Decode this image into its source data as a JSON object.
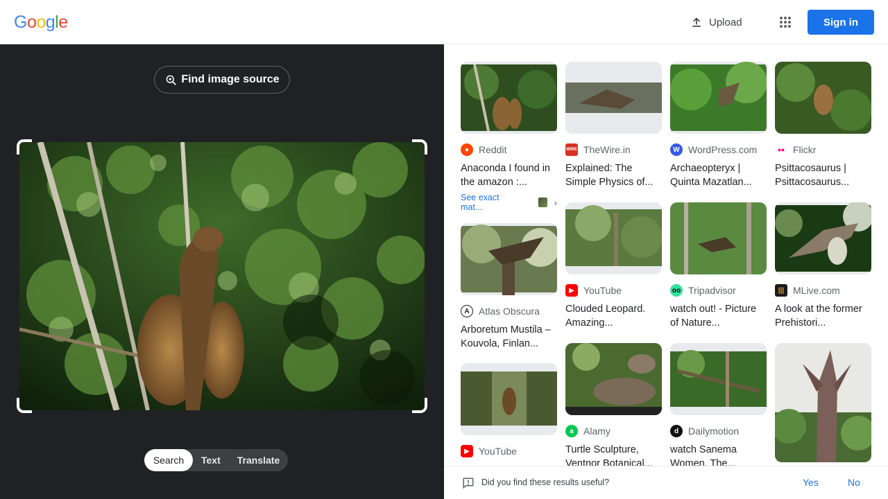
{
  "header": {
    "logo_letters": [
      "G",
      "o",
      "o",
      "g",
      "l",
      "e"
    ],
    "logo_colors": [
      "#4285f4",
      "#ea4335",
      "#fbbc05",
      "#4285f4",
      "#34a853",
      "#ea4335"
    ],
    "upload_label": "Upload",
    "signin_label": "Sign in",
    "accent_color": "#1a73e8"
  },
  "lens": {
    "find_source_label": "Find image source",
    "modes": [
      "Search",
      "Text",
      "Translate"
    ],
    "active_mode": "Search"
  },
  "results": [
    {
      "source": "Reddit",
      "title": "Anaconda I found in the amazon :...",
      "exact_matches_label": "See exact mat...",
      "favicon_icon": "reddit-icon",
      "favicon_color": "#ff4500"
    },
    {
      "source": "Atlas Obscura",
      "title": "Arboretum Mustila – Kouvola, Finlan...",
      "favicon_icon": "atlas-obscura-icon",
      "favicon_color": "#ffffff"
    },
    {
      "source": "YouTube",
      "title": "",
      "favicon_icon": "youtube-icon",
      "favicon_color": "#ff0000"
    },
    {
      "source": "TheWire.in",
      "title": "Explained: The Simple Physics of...",
      "favicon_icon": "thewire-icon",
      "favicon_color": "#d93025"
    },
    {
      "source": "YouTube",
      "title": "Clouded Leopard. Amazing...",
      "favicon_icon": "youtube-icon",
      "favicon_color": "#ff0000"
    },
    {
      "source": "Alamy",
      "title": "Turtle Sculpture, Ventnor Botanical...",
      "favicon_icon": "alamy-icon",
      "favicon_color": "#00c853"
    },
    {
      "source": "WordPress.com",
      "title": "Archaeopteryx | Quinta Mazatlan...",
      "favicon_icon": "wordpress-icon",
      "favicon_color": "#3858e9"
    },
    {
      "source": "Tripadvisor",
      "title": "watch out! - Picture of Nature...",
      "favicon_icon": "tripadvisor-icon",
      "favicon_color": "#34e0a1"
    },
    {
      "source": "Dailymotion",
      "title": "watch Sanema Women. The...",
      "favicon_icon": "dailymotion-icon",
      "favicon_color": "#111111"
    },
    {
      "source": "Flickr",
      "title": "Psittacosaurus | Psittacosaurus...",
      "favicon_icon": "flickr-icon",
      "favicon_color": "#ff0084"
    },
    {
      "source": "MLive.com",
      "title": "A look at the former Prehistori...",
      "favicon_icon": "mlive-icon",
      "favicon_color": "#1a1a1a"
    }
  ],
  "feedback": {
    "question": "Did you find these results useful?",
    "yes_label": "Yes",
    "no_label": "No"
  }
}
